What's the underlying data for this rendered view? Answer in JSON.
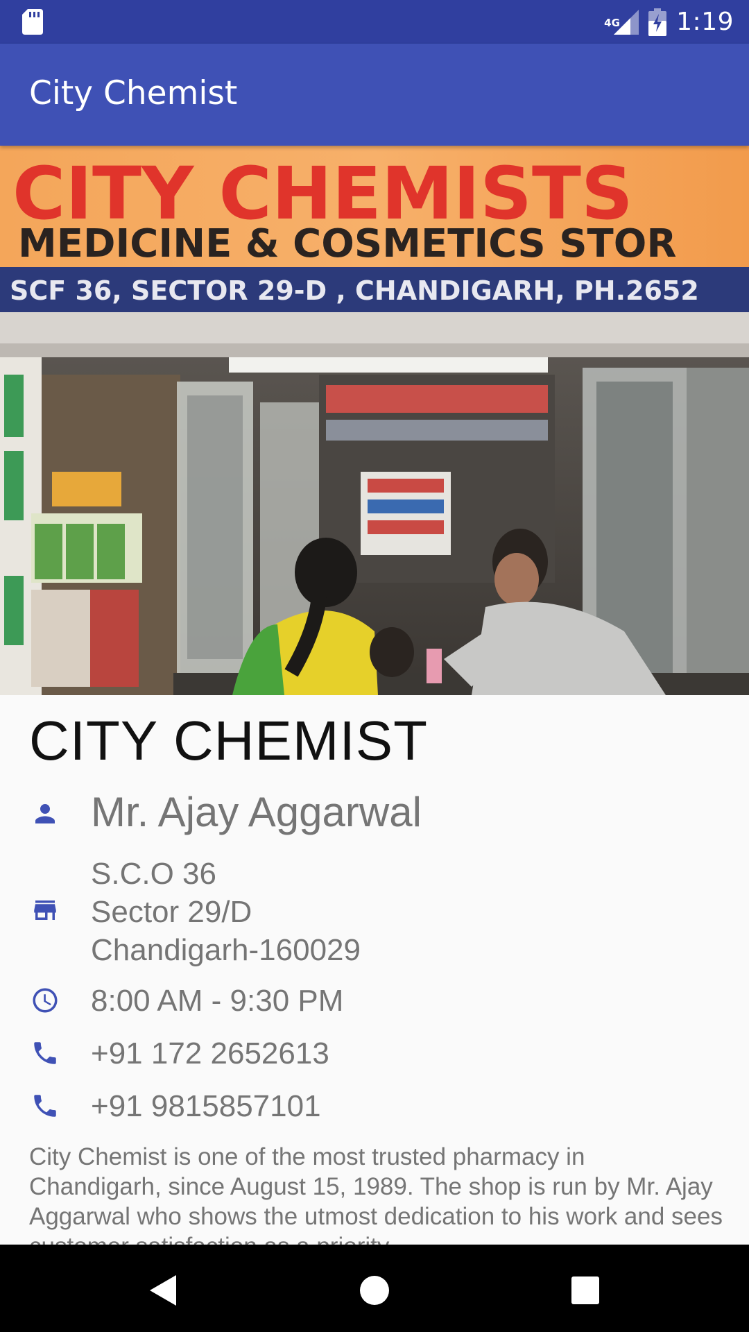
{
  "status_bar": {
    "time": "1:19",
    "network": "4G",
    "icons": [
      "sd-card-icon",
      "signal-icon",
      "battery-charging-icon"
    ]
  },
  "app_bar": {
    "title": "City Chemist"
  },
  "hero": {
    "sign_title": "CITY CHEMISTS",
    "sign_subtitle": "MEDICINE & COSMETICS STOR",
    "sign_address": "SCF 36, SECTOR 29-D , CHANDIGARH, PH.2652"
  },
  "shop": {
    "name": "CITY CHEMIST",
    "owner": "Mr. Ajay Aggarwal",
    "address": [
      "S.C.O 36",
      "Sector 29/D",
      "Chandigarh-160029"
    ],
    "hours": "8:00 AM - 9:30 PM",
    "phones": [
      "+91 172 2652613",
      "+91 9815857101"
    ],
    "about": "City Chemist is one of the most trusted pharmacy in Chandigarh, since August 15, 1989. The shop is run by Mr. Ajay Aggarwal who shows the utmost dedication to his work and sees customer satisfaction as a priority."
  },
  "theme": {
    "primary": "#3f51b5",
    "primary_dark": "#303f9f",
    "icon_color": "#3f51b5",
    "secondary_text": "#757575"
  },
  "nav": {
    "icons": [
      "back-icon",
      "home-icon",
      "recents-icon"
    ]
  }
}
